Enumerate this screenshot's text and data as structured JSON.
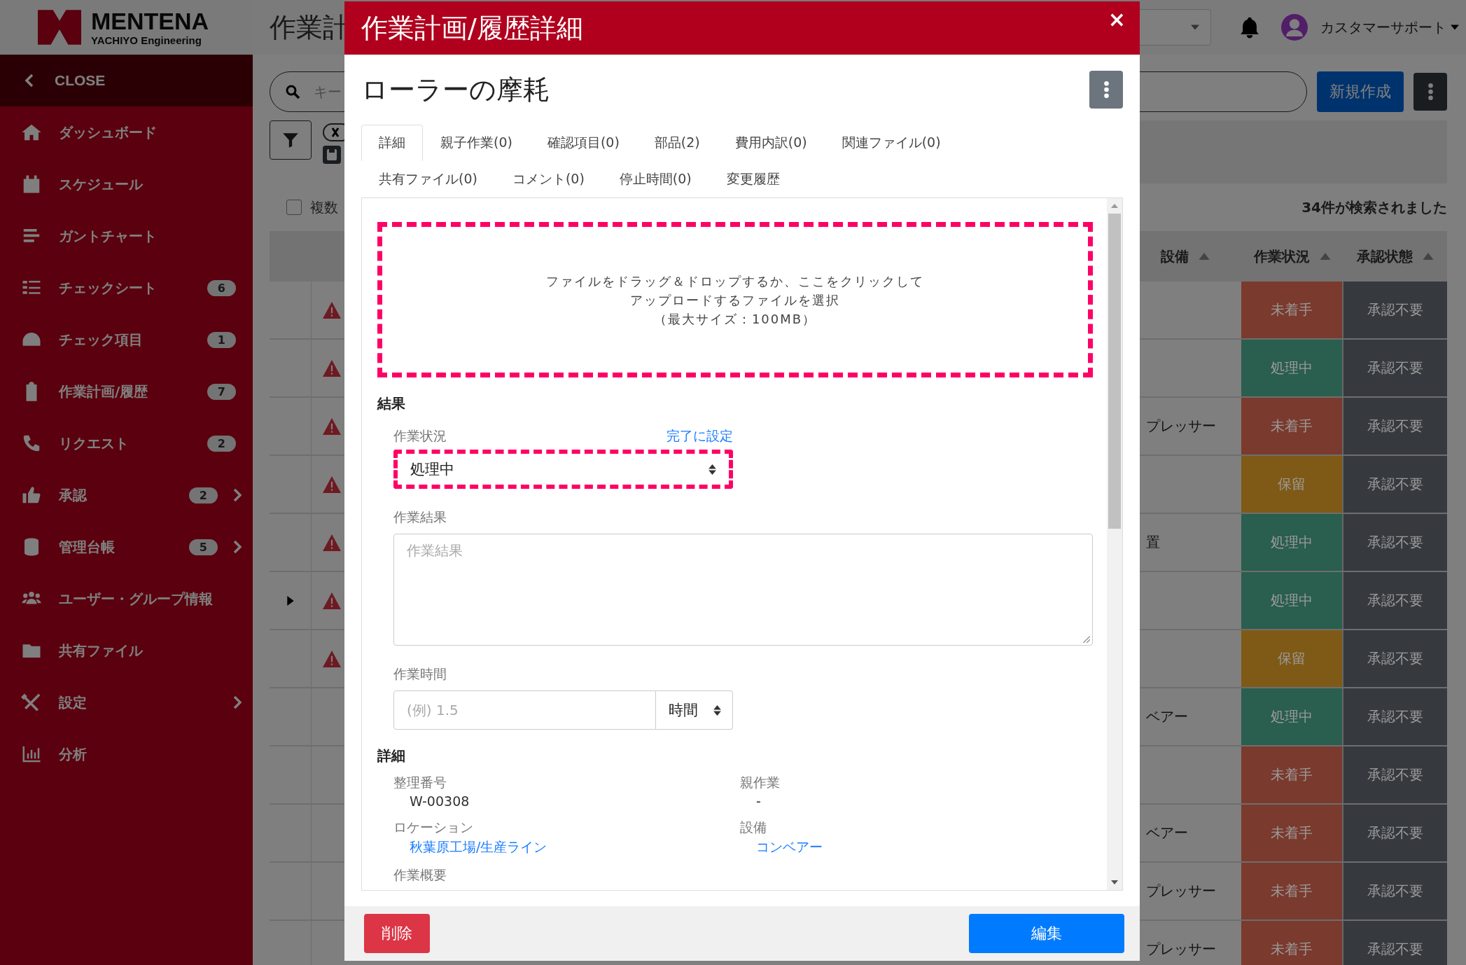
{
  "sidebar": {
    "brand": "MENTENA",
    "brand_sub": "YACHIYO Engineering",
    "close": "CLOSE",
    "items": [
      {
        "label": "ダッシュボード",
        "submenu": false
      },
      {
        "label": "スケジュール",
        "submenu": false
      },
      {
        "label": "ガントチャート",
        "submenu": false
      },
      {
        "label": "チェックシート",
        "badge": "6",
        "submenu": false
      },
      {
        "label": "チェック項目",
        "badge": "1",
        "submenu": false
      },
      {
        "label": "作業計画/履歴",
        "badge": "7",
        "submenu": false
      },
      {
        "label": "リクエスト",
        "badge": "2",
        "submenu": false
      },
      {
        "label": "承認",
        "badge": "2",
        "submenu": true
      },
      {
        "label": "管理台帳",
        "badge": "5",
        "submenu": true
      },
      {
        "label": "ユーザー・グループ情報",
        "submenu": false
      },
      {
        "label": "共有ファイル",
        "submenu": false
      },
      {
        "label": "設定",
        "submenu": true
      },
      {
        "label": "分析",
        "submenu": false
      }
    ]
  },
  "header": {
    "title": "作業計",
    "user": "カスタマーサポート"
  },
  "toolbar": {
    "search_placeholder": "キー",
    "new_button": "新規作成"
  },
  "filter": {
    "checkbox_label": "複数",
    "checked": false
  },
  "result_count": "34件が検索されました",
  "table": {
    "columns": [
      "設備",
      "作業状況",
      "承認状態"
    ],
    "rows": [
      {
        "warning": true,
        "expandable": false,
        "status": "未着手",
        "color": "#7a3a2d",
        "approval": "承認不要"
      },
      {
        "warning": true,
        "expandable": false,
        "status": "処理中",
        "color": "#2a5e4e",
        "approval": "承認不要"
      },
      {
        "warning": true,
        "expandable": false,
        "equipment": "プレッサー",
        "status": "未着手",
        "color": "#7a3a2d",
        "approval": "承認不要"
      },
      {
        "warning": true,
        "expandable": false,
        "status": "保留",
        "color": "#7f5a16",
        "approval": "承認不要"
      },
      {
        "warning": true,
        "expandable": false,
        "equipment": "置",
        "status": "処理中",
        "color": "#2a5e4e",
        "approval": "承認不要"
      },
      {
        "warning": true,
        "expandable": true,
        "status": "処理中",
        "color": "#2a5e4e",
        "approval": "承認不要"
      },
      {
        "warning": true,
        "expandable": false,
        "status": "保留",
        "color": "#7f5a16",
        "approval": "承認不要"
      },
      {
        "warning": false,
        "expandable": false,
        "equipment": "ベアー",
        "status": "処理中",
        "color": "#2a5e4e",
        "approval": "承認不要"
      },
      {
        "warning": false,
        "expandable": false,
        "status": "未着手",
        "color": "#7a3a2d",
        "approval": "承認不要"
      },
      {
        "warning": false,
        "expandable": false,
        "equipment": "ベアー",
        "status": "未着手",
        "color": "#7a3a2d",
        "approval": "承認不要"
      },
      {
        "warning": false,
        "expandable": false,
        "equipment": "プレッサー",
        "status": "未着手",
        "color": "#7a3a2d",
        "approval": "承認不要"
      },
      {
        "warning": false,
        "expandable": false,
        "equipment": "プレッサー",
        "status": "未着手",
        "color": "#7a3a2d",
        "approval": "承認不要"
      }
    ]
  },
  "modal": {
    "title": "作業計画/履歴詳細",
    "close": "×",
    "heading": "ローラーの摩耗",
    "tabs": [
      {
        "label": "詳細",
        "selected": true
      },
      {
        "label": "親子作業(0)",
        "selected": false
      },
      {
        "label": "確認項目(0)",
        "selected": false
      },
      {
        "label": "部品(2)",
        "selected": false
      },
      {
        "label": "費用内訳(0)",
        "selected": false
      },
      {
        "label": "関連ファイル(0)",
        "selected": false
      },
      {
        "label": "共有ファイル(0)",
        "selected": false
      },
      {
        "label": "コメント(0)",
        "selected": false
      },
      {
        "label": "停止時間(0)",
        "selected": false
      },
      {
        "label": "変更履歴",
        "selected": false
      }
    ],
    "dropzone": {
      "highlighted": true,
      "lines": [
        "ファイルをドラッグ＆ドロップするか、ここをクリックして",
        "アップロードするファイルを選択",
        "（最大サイズ：100MB）"
      ]
    },
    "result": {
      "heading": "結果",
      "status_label": "作業状況",
      "set_done": "完了に設定",
      "status_value": "処理中",
      "status_highlighted": true,
      "result_label": "作業結果",
      "result_placeholder": "作業結果",
      "time_label": "作業時間",
      "time_placeholder": "(例) 1.5",
      "time_unit": "時間"
    },
    "details": {
      "heading": "詳細",
      "fields": [
        {
          "label": "整理番号",
          "value": "W-00308",
          "link": false
        },
        {
          "label": "親作業",
          "value": "-",
          "link": false
        },
        {
          "label": "ロケーション",
          "value": "秋葉原工場/生産ライン",
          "link": true
        },
        {
          "label": "設備",
          "value": "コンベアー",
          "link": true
        },
        {
          "label": "作業概要",
          "link": false
        }
      ]
    },
    "delete_button": "削除",
    "edit_button": "編集"
  }
}
